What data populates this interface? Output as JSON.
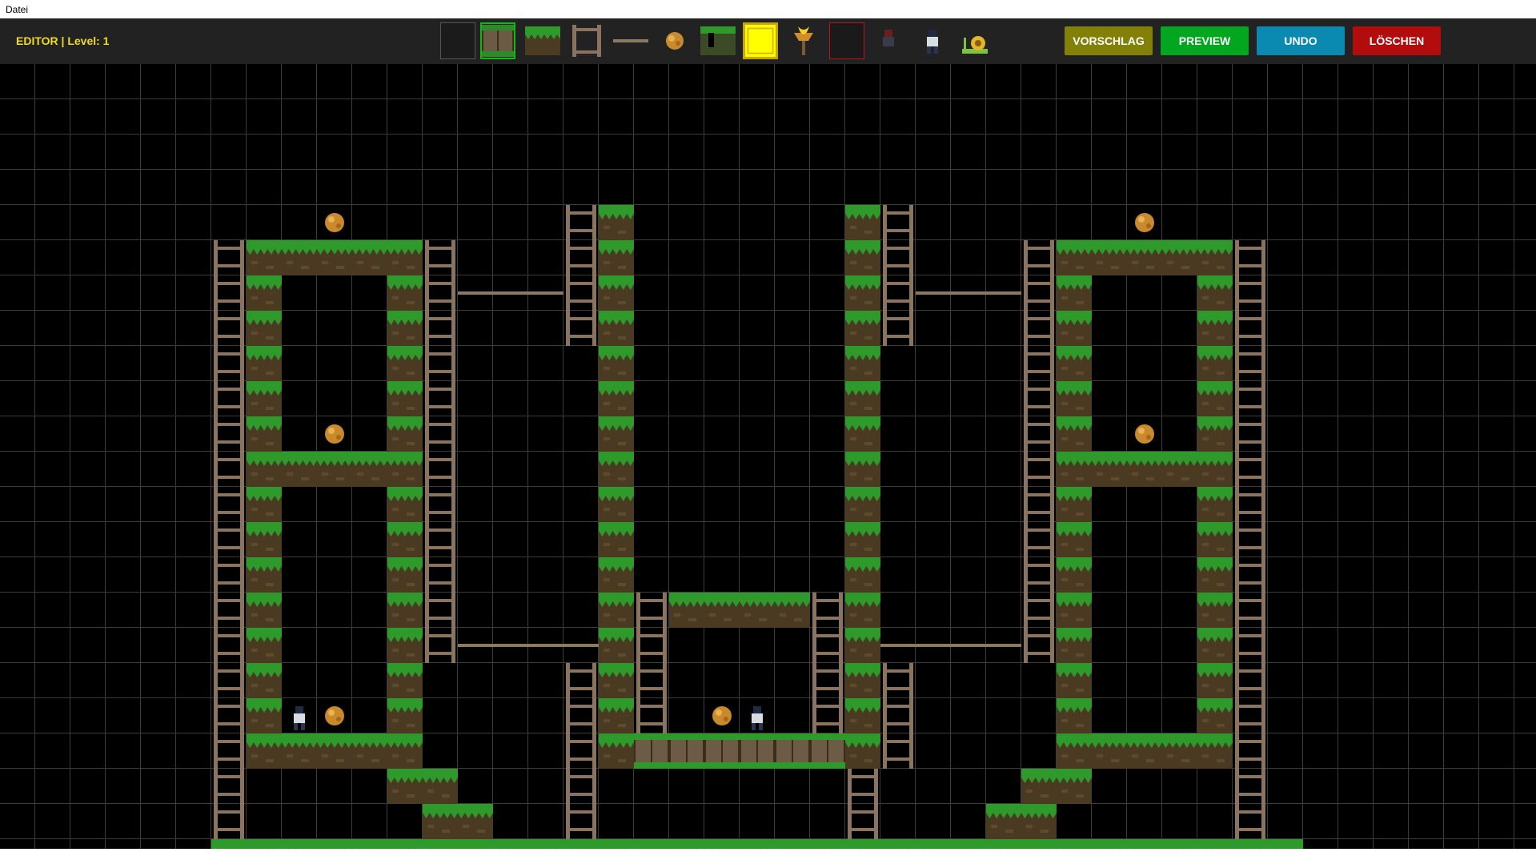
{
  "window": {
    "menu": [
      "Datei"
    ]
  },
  "toolbar": {
    "title": "EDITOR | Level: 1",
    "palette": [
      "empty-tile",
      "brick-tile",
      "grass-tile",
      "ladder",
      "rope",
      "gold",
      "trapdoor-tile",
      "solid-block",
      "torch",
      "eraser",
      "enemy",
      "player",
      "snail"
    ],
    "selected": "brick-tile",
    "buttons": [
      {
        "id": "vorschlag",
        "label": "VORSCHLAG",
        "color": "#838007"
      },
      {
        "id": "preview",
        "label": "PREVIEW",
        "color": "#02a61f"
      },
      {
        "id": "undo",
        "label": "UNDO",
        "color": "#0b8ab1"
      },
      {
        "id": "loeschen",
        "label": "LÖSCHEN",
        "color": "#b30c0c"
      }
    ]
  },
  "level": {
    "cols": 44,
    "rows": 23,
    "map": [
      "............................................",
      "............................................",
      "............................................",
      "............................................",
      ".........G......HT......TH......G...........",
      "......H#####H...HT......TH...H#####H.........",
      "......H#...#H---HT......TH---H#...#H.........",
      "......H#...#H...HT......TH...H#...#H.........",
      "......H#...#H....T......T....H#...#H.........",
      "......H#...#H....T......T....H#...#H.........",
      "......H#.G.#H....T......T....H#.G.#H.........",
      "......H#####H....T......T....H#####H.........",
      "......H#...#H....T......T....H#...#H.........",
      "......H#...#H....T......T....H#...#H.........",
      "......H#...#H....T......T....H#...#H.........",
      "......H#...#H....TH####HT....H#...#H.........",
      "......H#...#H----TH....HT----H#...#H.........",
      "......H#...#....HTH....HTH....#...#H.........",
      "......H#PG.#....HTH.GP.HTH....#...#H.........",
      "......H#####....HTBBBBBBTH....#####H.........",
      "......H....##...H.......H....##....H.........",
      "......H.....##..H.......H...##.....H.........",
      "......H......##P.H...E....H.##......H........."
    ]
  }
}
